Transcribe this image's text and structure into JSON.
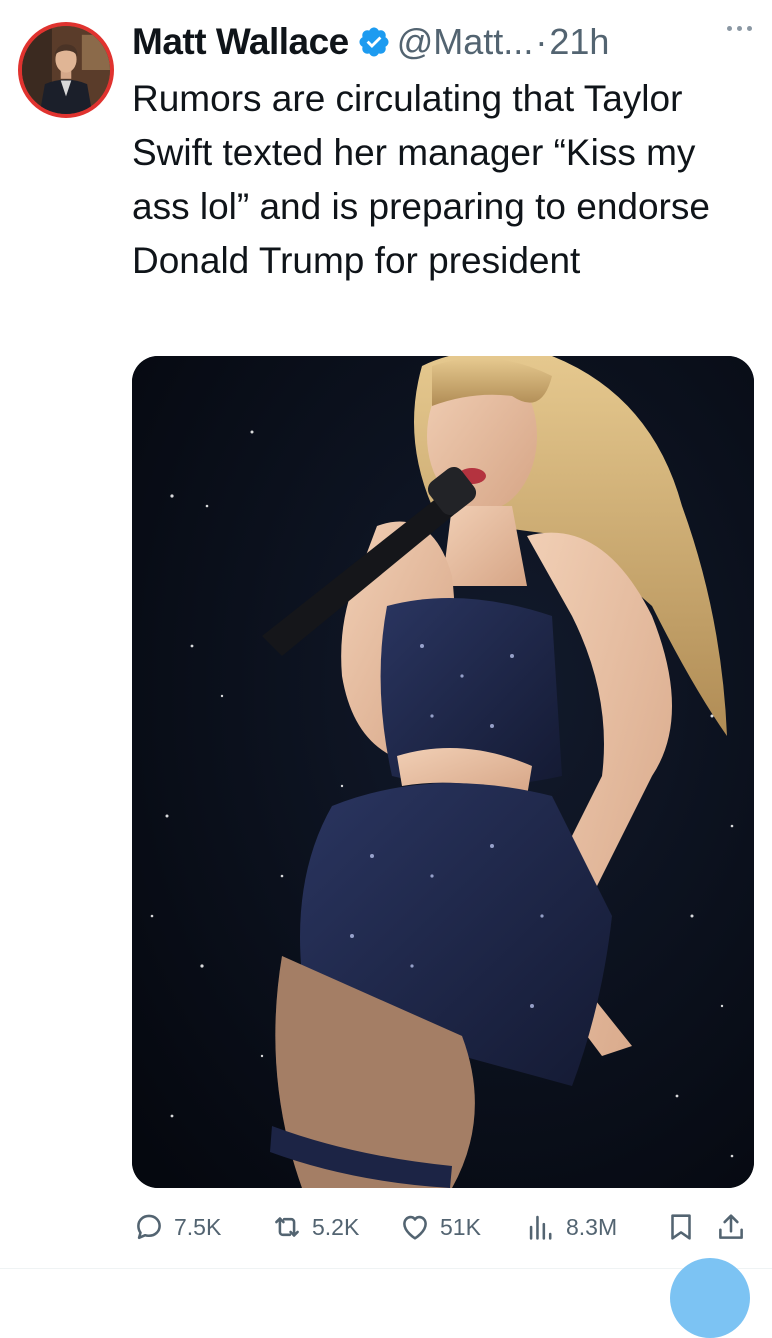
{
  "tweet": {
    "author": {
      "name": "Matt Wallace",
      "handle": "@Matt...",
      "separator": "·",
      "time": "21h"
    },
    "text": "Rumors are circulating that Taylor Swift texted her manager “Kiss my ass lol” and is preparing to endorse Donald Trump for president",
    "metrics": {
      "replies": "7.5K",
      "reposts": "5.2K",
      "likes": "51K",
      "views": "8.3M"
    }
  },
  "icons": {
    "verified": "verified-badge-icon",
    "more": "more-options-icon",
    "reply": "reply-icon",
    "repost": "repost-icon",
    "like": "heart-icon",
    "views": "views-chart-icon",
    "bookmark": "bookmark-icon",
    "share": "share-icon"
  },
  "colors": {
    "accent": "#1d9bf0",
    "muted_text": "#536471",
    "avatar_ring": "#e0332f"
  }
}
